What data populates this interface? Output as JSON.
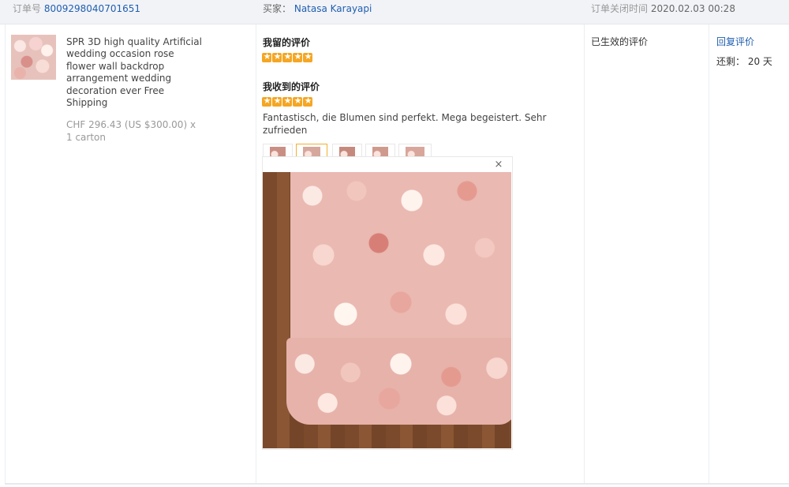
{
  "header": {
    "order_label": "订单号",
    "order_number": "8009298040701651",
    "buyer_label": "买家：",
    "buyer_name": "Natasa Karayapi",
    "close_time_label": "订单关闭时间",
    "close_time": "2020.02.03 00:28"
  },
  "product": {
    "title": "SPR 3D high quality Artificial wedding occasion rose flower wall backdrop arrangement wedding decoration ever Free Shipping",
    "price_line": "CHF 296.43 (US $300.00) x 1 carton"
  },
  "reviews": {
    "my_review_heading": "我留的评价",
    "my_review_stars": 5,
    "received_review_heading": "我收到的评价",
    "received_review_stars": 5,
    "received_review_text": "Fantastisch, die Blumen sind perfekt. Mega begeistert. Sehr zufrieden",
    "photo_count": 5,
    "selected_photo_index": 1,
    "close_symbol": "×"
  },
  "status": {
    "effective_label": "已生效的评价"
  },
  "action": {
    "reply_label": "回复评价",
    "remaining_text": "还剩： 20 天"
  },
  "colors": {
    "accent_link": "#1f5fb0",
    "star": "#f5a623",
    "selected_thumb_border": "#f0b030"
  }
}
